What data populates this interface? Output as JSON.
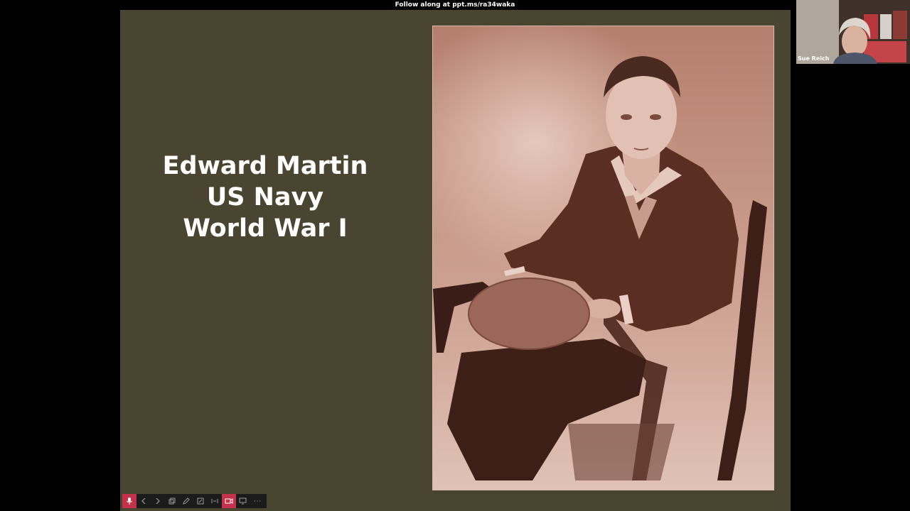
{
  "meeting": {
    "follow_along": "Follow along at ppt.ms/ra34waka"
  },
  "slide": {
    "background": "#4a4530",
    "title_lines": [
      "Edward Martin",
      "US Navy",
      "World War I"
    ],
    "photo_subject": "sepia portrait of a seated sailor in uniform holding a cap"
  },
  "participant": {
    "name": "Sue Reich"
  },
  "toolbar": {
    "items": [
      "microphone-icon",
      "previous-slide-icon",
      "next-slide-icon",
      "slides-overview-icon",
      "pen-icon",
      "laser-pointer-icon",
      "subtitles-icon",
      "camera-icon",
      "share-screen-icon",
      "more-options-icon"
    ],
    "more_label": "···",
    "accent": "#c4314b"
  }
}
